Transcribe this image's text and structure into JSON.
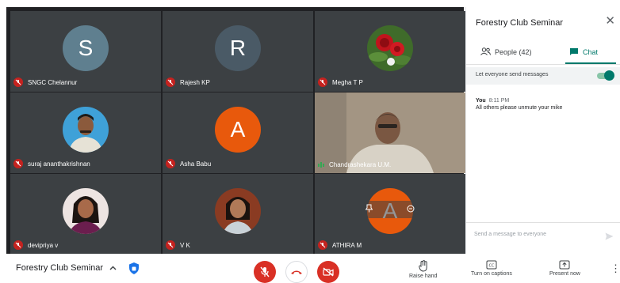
{
  "meeting": {
    "title": "Forestry Club Seminar"
  },
  "tiles": [
    {
      "name": "SNGC Chelannur",
      "initial": "S",
      "avatar_color": "#5f7f8f"
    },
    {
      "name": "Rajesh KP",
      "initial": "R",
      "avatar_color": "#4a5a66"
    },
    {
      "name": "Megha T P"
    },
    {
      "name": "suraj ananthakrishnan"
    },
    {
      "name": "Asha Babu",
      "initial": "A",
      "avatar_color": "#e8590c"
    },
    {
      "name": "Chandrashekara U.M."
    },
    {
      "name": "devipriya v"
    },
    {
      "name": "V K"
    },
    {
      "name": "ATHIRA M",
      "initial": "A",
      "avatar_color": "#e8590c"
    }
  ],
  "panel": {
    "title": "Forestry Club Seminar",
    "tabs": [
      {
        "label": "People (42)"
      },
      {
        "label": "Chat"
      }
    ],
    "setting_label": "Let everyone send messages",
    "message": {
      "sender": "You",
      "time": "8:11 PM",
      "text": "All others please unmute your mike"
    },
    "compose_placeholder": "Send a message to everyone"
  },
  "controls": {
    "raise_hand": "Raise hand",
    "captions": "Turn on captions",
    "present": "Present now"
  },
  "colors": {
    "accent": "#00796b",
    "danger": "#d93025",
    "tile_bg": "#3c4043",
    "grid_bg": "#202124"
  }
}
